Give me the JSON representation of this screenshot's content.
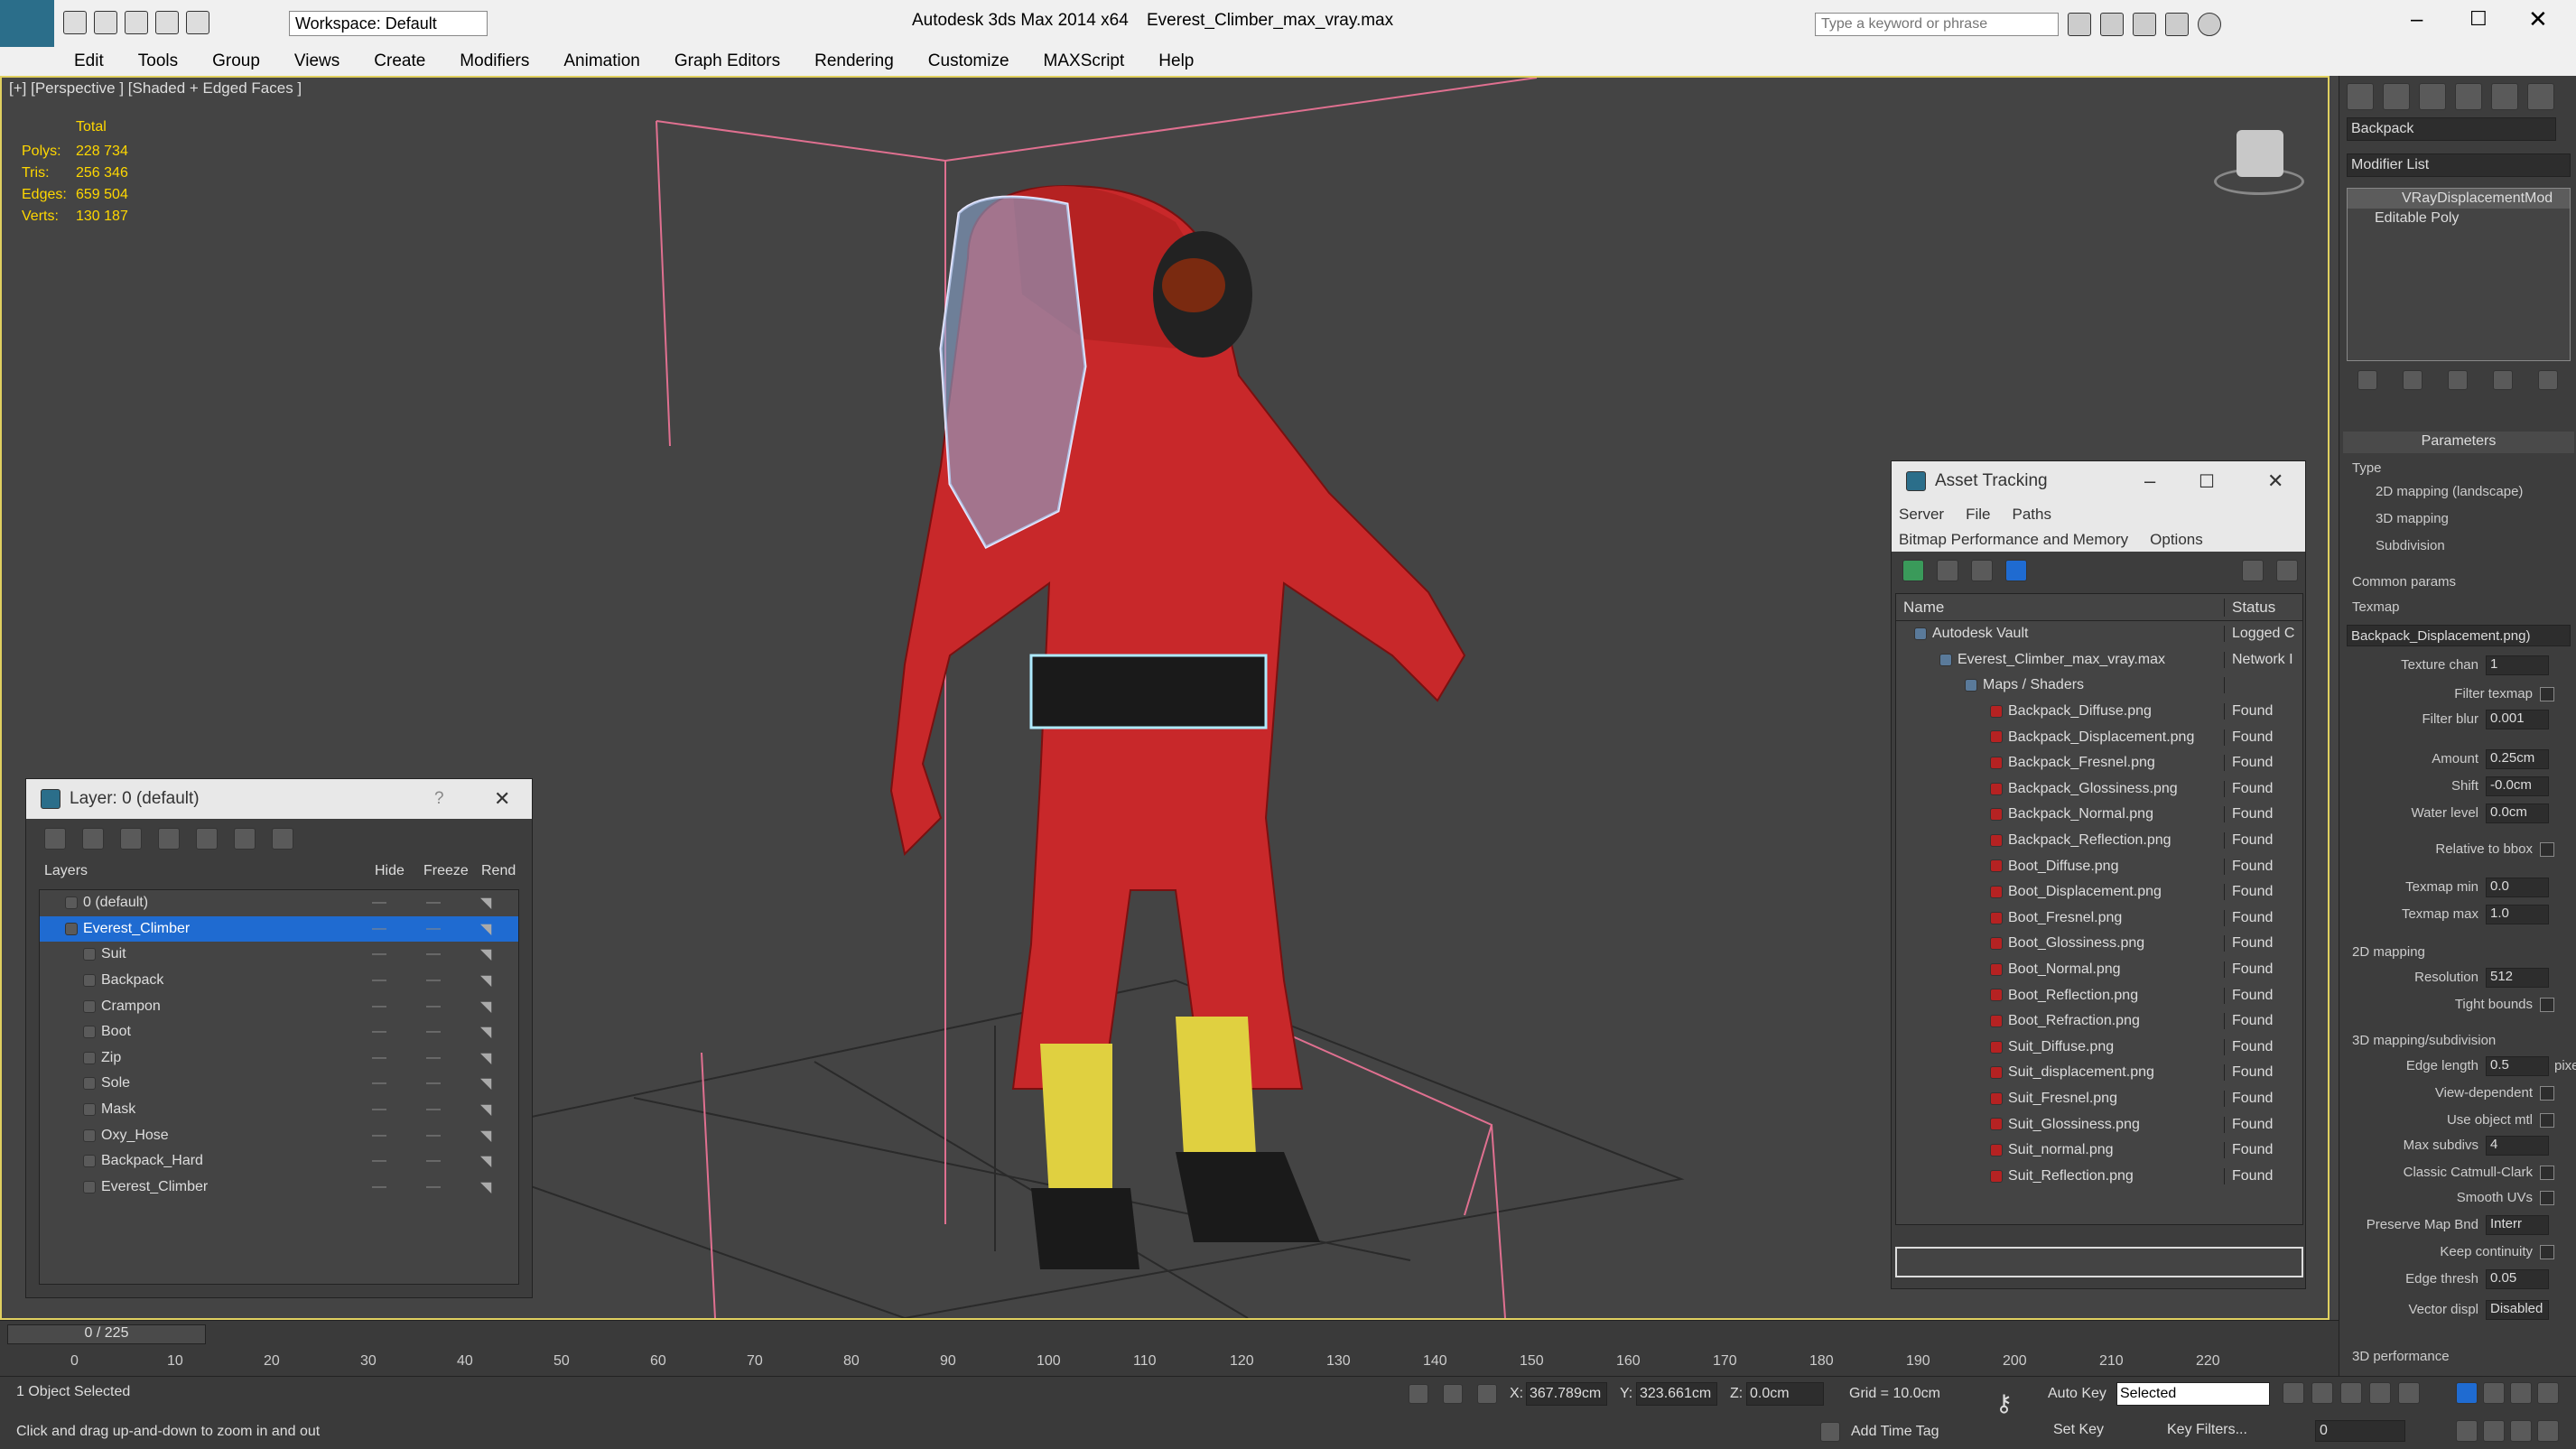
{
  "titlebar": {
    "workspace_label": "Workspace: Default",
    "app_title": "Autodesk 3ds Max  2014 x64",
    "file_title": "Everest_Climber_max_vray.max",
    "search_placeholder": "Type a keyword or phrase"
  },
  "menu": [
    "Edit",
    "Tools",
    "Group",
    "Views",
    "Create",
    "Modifiers",
    "Animation",
    "Graph Editors",
    "Rendering",
    "Customize",
    "MAXScript",
    "Help"
  ],
  "viewport": {
    "label": "[+] [Perspective ] [Shaded + Edged Faces ]",
    "stats_header": "Total",
    "stats": [
      {
        "name": "Polys:",
        "value": "228 734"
      },
      {
        "name": "Tris:",
        "value": "256 346"
      },
      {
        "name": "Edges:",
        "value": "659 504"
      },
      {
        "name": "Verts:",
        "value": "130 187"
      }
    ]
  },
  "layer_panel": {
    "title": "Layer: 0 (default)",
    "help": "?",
    "col_layers": "Layers",
    "col_hide": "Hide",
    "col_freeze": "Freeze",
    "col_render": "Rend",
    "rows": [
      {
        "name": "0 (default)",
        "level": 0
      },
      {
        "name": "Everest_Climber",
        "level": 0
      },
      {
        "name": "Suit",
        "level": 1
      },
      {
        "name": "Backpack",
        "level": 1
      },
      {
        "name": "Crampon",
        "level": 1
      },
      {
        "name": "Boot",
        "level": 1
      },
      {
        "name": "Zip",
        "level": 1
      },
      {
        "name": "Sole",
        "level": 1
      },
      {
        "name": "Mask",
        "level": 1
      },
      {
        "name": "Oxy_Hose",
        "level": 1
      },
      {
        "name": "Backpack_Hard",
        "level": 1
      },
      {
        "name": "Everest_Climber",
        "level": 1
      }
    ]
  },
  "asset_panel": {
    "title": "Asset Tracking",
    "menu1": [
      "Server",
      "File",
      "Paths"
    ],
    "menu2": [
      "Bitmap Performance and Memory",
      "Options"
    ],
    "col_name": "Name",
    "col_status": "Status",
    "rows": [
      {
        "name": "Autodesk Vault",
        "status": "Logged C",
        "level": 0
      },
      {
        "name": "Everest_Climber_max_vray.max",
        "status": "Network I",
        "level": 1
      },
      {
        "name": "Maps / Shaders",
        "status": "",
        "level": 2
      },
      {
        "name": "Backpack_Diffuse.png",
        "status": "Found",
        "level": 3
      },
      {
        "name": "Backpack_Displacement.png",
        "status": "Found",
        "level": 3
      },
      {
        "name": "Backpack_Fresnel.png",
        "status": "Found",
        "level": 3
      },
      {
        "name": "Backpack_Glossiness.png",
        "status": "Found",
        "level": 3
      },
      {
        "name": "Backpack_Normal.png",
        "status": "Found",
        "level": 3
      },
      {
        "name": "Backpack_Reflection.png",
        "status": "Found",
        "level": 3
      },
      {
        "name": "Boot_Diffuse.png",
        "status": "Found",
        "level": 3
      },
      {
        "name": "Boot_Displacement.png",
        "status": "Found",
        "level": 3
      },
      {
        "name": "Boot_Fresnel.png",
        "status": "Found",
        "level": 3
      },
      {
        "name": "Boot_Glossiness.png",
        "status": "Found",
        "level": 3
      },
      {
        "name": "Boot_Normal.png",
        "status": "Found",
        "level": 3
      },
      {
        "name": "Boot_Reflection.png",
        "status": "Found",
        "level": 3
      },
      {
        "name": "Boot_Refraction.png",
        "status": "Found",
        "level": 3
      },
      {
        "name": "Suit_Diffuse.png",
        "status": "Found",
        "level": 3
      },
      {
        "name": "Suit_displacement.png",
        "status": "Found",
        "level": 3
      },
      {
        "name": "Suit_Fresnel.png",
        "status": "Found",
        "level": 3
      },
      {
        "name": "Suit_Glossiness.png",
        "status": "Found",
        "level": 3
      },
      {
        "name": "Suit_normal.png",
        "status": "Found",
        "level": 3
      },
      {
        "name": "Suit_Reflection.png",
        "status": "Found",
        "level": 3
      }
    ]
  },
  "command_panel": {
    "object_name": "Backpack",
    "modifier_list": "Modifier List",
    "stack": [
      "VRayDisplacementMod",
      "Editable Poly"
    ],
    "parameters": "Parameters",
    "type_label": "Type",
    "type_options": [
      "2D mapping (landscape)",
      "3D mapping",
      "Subdivision"
    ],
    "common_params": "Common params",
    "texmap": "Texmap",
    "texmap_value": "Backpack_Displacement.png)",
    "texture_chan": "Texture chan",
    "texture_chan_value": "1",
    "filter_texmap": "Filter texmap",
    "filter_blur": "Filter blur",
    "filter_blur_value": "0.001",
    "amount": "Amount",
    "amount_value": "0.25cm",
    "shift": "Shift",
    "shift_value": "-0.0cm",
    "water_level": "Water level",
    "water_level_value": "0.0cm",
    "relative_bbox": "Relative to bbox",
    "texmap_min": "Texmap min",
    "texmap_min_value": "0.0",
    "texmap_max": "Texmap max",
    "texmap_max_value": "1.0",
    "mapping_2d": "2D mapping",
    "resolution": "Resolution",
    "resolution_value": "512",
    "tight_bounds": "Tight bounds",
    "mapping_3d": "3D mapping/subdivision",
    "edge_length": "Edge length",
    "edge_length_value": "0.5",
    "pixels": "pixels",
    "view_dependent": "View-dependent",
    "use_object_mtl": "Use object mtl",
    "max_subdivs": "Max subdivs",
    "max_subdivs_value": "4",
    "classic_catmull": "Classic Catmull-Clark",
    "smooth_uvs": "Smooth UVs",
    "preserve_map": "Preserve Map Bnd",
    "preserve_map_value": "Interr",
    "keep_continuity": "Keep continuity",
    "edge_thresh": "Edge thresh",
    "edge_thresh_value": "0.05",
    "vector_displ": "Vector displ",
    "vector_displ_value": "Disabled",
    "perf": "3D performance"
  },
  "timeline": {
    "frame": "0 / 225",
    "ticks": [
      "0",
      "10",
      "20",
      "30",
      "40",
      "50",
      "60",
      "70",
      "80",
      "90",
      "100",
      "110",
      "120",
      "130",
      "140",
      "150",
      "160",
      "170",
      "180",
      "190",
      "200",
      "210",
      "220"
    ]
  },
  "status": {
    "selected": "1 Object Selected",
    "hint": "Click and drag up-and-down to zoom in and out",
    "x_label": "X:",
    "x_value": "367.789cm",
    "y_label": "Y:",
    "y_value": "323.661cm",
    "z_label": "Z:",
    "z_value": "0.0cm",
    "grid": "Grid = 10.0cm",
    "auto_key": "Auto Key",
    "set_key": "Set Key",
    "selected_dropdown": "Selected",
    "key_filters": "Key Filters...",
    "add_time_tag": "Add Time Tag",
    "frame_field": "0"
  }
}
